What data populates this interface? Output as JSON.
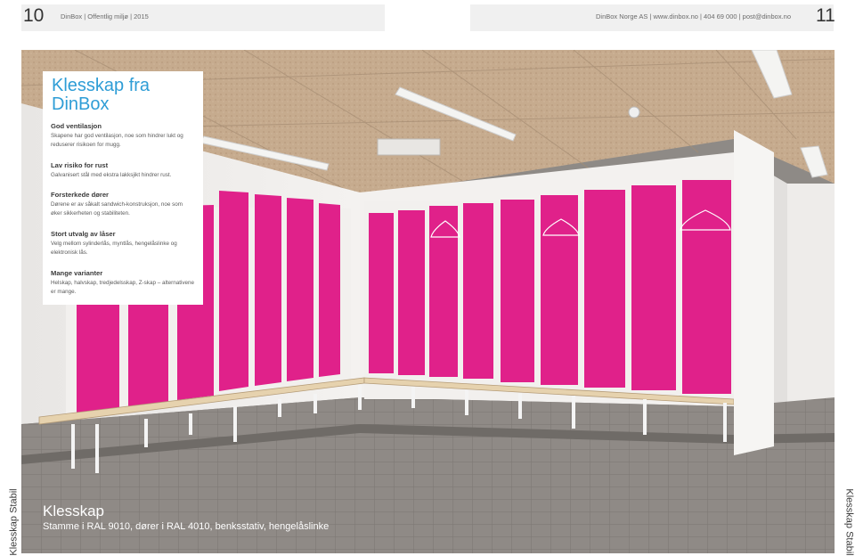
{
  "header": {
    "left_page_number": "10",
    "left_text": "DinBox | Offentlig miljø | 2015",
    "right_text": "DinBox Norge AS | www.dinbox.no | 404 69 000 | post@dinbox.no",
    "right_page_number": "11"
  },
  "infobox": {
    "title": "Klesskap fra DinBox",
    "sections": [
      {
        "heading": "God ventilasjon",
        "text": "Skapene har god ventilasjon, noe som hindrer lukt og reduserer risikoen for mugg."
      },
      {
        "heading": "Lav risiko for rust",
        "text": "Galvanisert stål med ekstra lakksjikt hindrer rust."
      },
      {
        "heading": "Forsterkede dører",
        "text": "Dørene er av såkalt sandwich-konstruksjon, noe som øker sikkerheten og stabiliteten."
      },
      {
        "heading": "Stort utvalg av låser",
        "text": "Velg mellom sylinderlås, myntlås, hengelåslinke og elektronisk lås."
      },
      {
        "heading": "Mange varianter",
        "text": "Helskap, halvskap, tredjedelsskap, Z-skap – alternativene er mange."
      }
    ]
  },
  "caption": {
    "title": "Klesskap",
    "subtitle": "Stamme i RAL 9010, dører i RAL 4010, benksstativ, hengelåslinke"
  },
  "side_label": "Klesskap Stabil",
  "colors": {
    "accent_blue": "#2e9dd6",
    "locker_pink": "#e0218a",
    "frame_white": "#f2f0ee"
  }
}
